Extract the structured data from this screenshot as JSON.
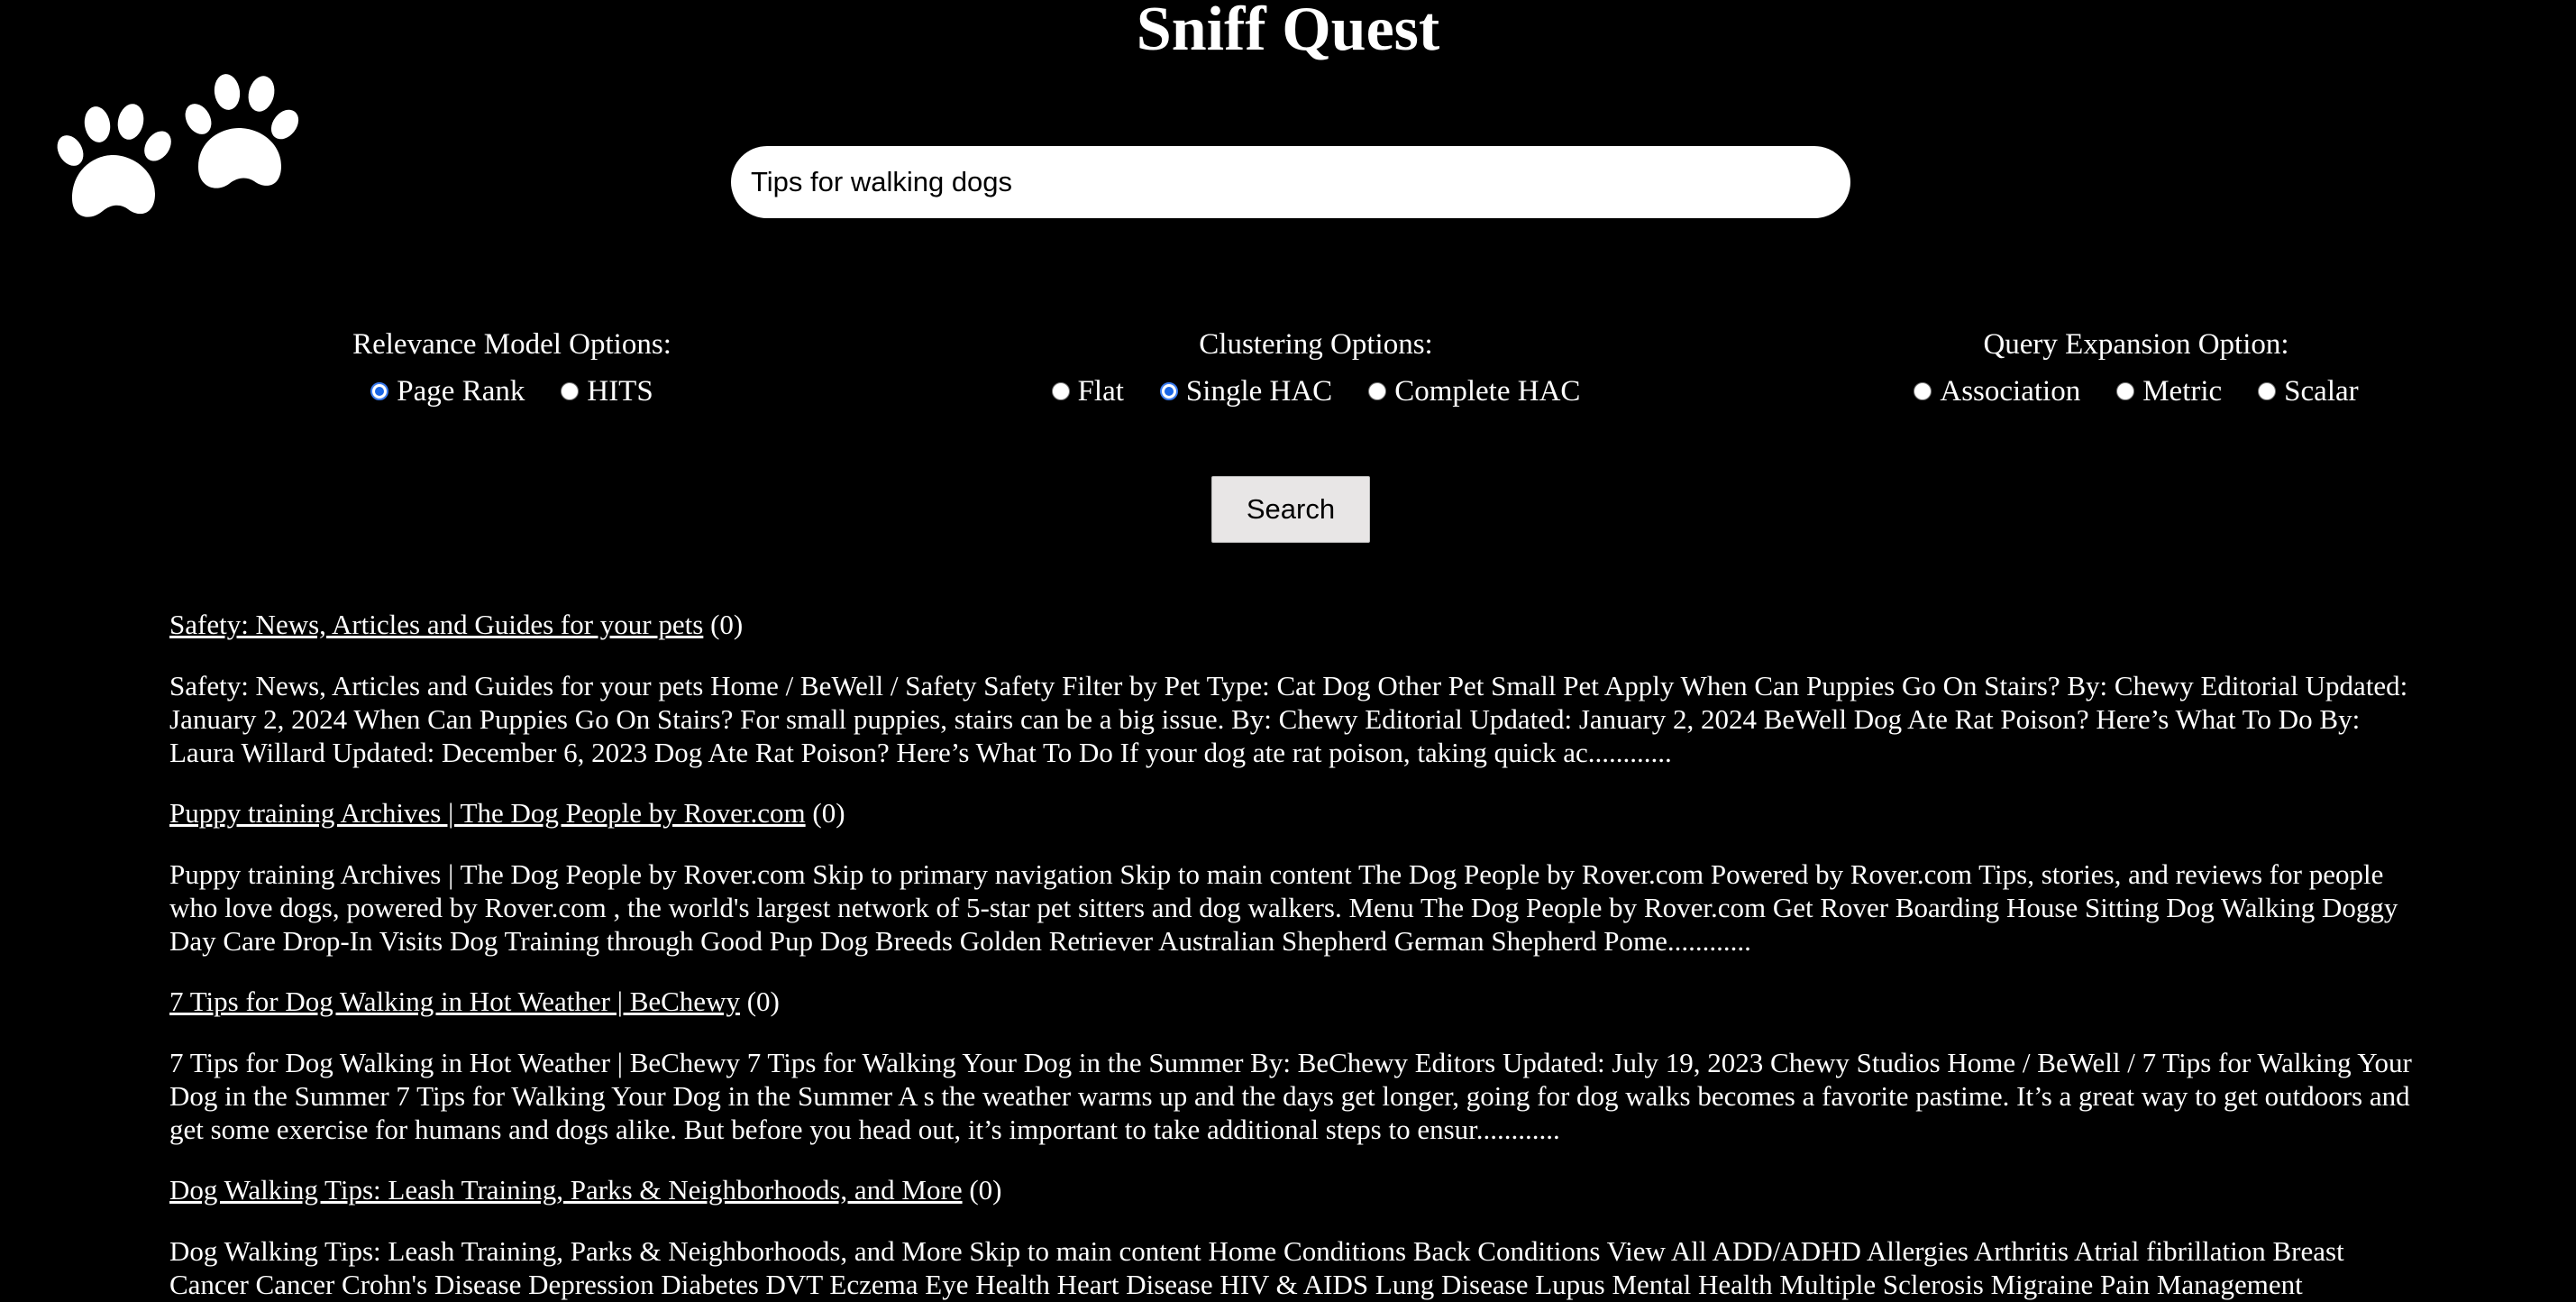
{
  "header": {
    "title": "Sniff Quest",
    "logo_icon": "paw-prints-icon"
  },
  "search": {
    "query": "Tips for walking dogs",
    "button_label": "Search"
  },
  "options": {
    "relevance": {
      "label": "Relevance Model Options:",
      "choices": [
        {
          "label": "Page Rank",
          "checked": true
        },
        {
          "label": "HITS",
          "checked": false
        }
      ]
    },
    "clustering": {
      "label": "Clustering Options:",
      "choices": [
        {
          "label": "Flat",
          "checked": false
        },
        {
          "label": "Single HAC",
          "checked": true
        },
        {
          "label": "Complete HAC",
          "checked": false
        }
      ]
    },
    "expansion": {
      "label": "Query Expansion Option:",
      "choices": [
        {
          "label": "Association",
          "checked": false
        },
        {
          "label": "Metric",
          "checked": false
        },
        {
          "label": "Scalar",
          "checked": false
        }
      ]
    }
  },
  "results": [
    {
      "title": "Safety: News, Articles and Guides for your pets",
      "count": "(0)",
      "snippet": "Safety: News, Articles and Guides for your pets Home / BeWell / Safety Safety Filter by Pet Type: Cat Dog Other Pet Small Pet Apply When Can Puppies Go On Stairs? By: Chewy Editorial Updated: January 2, 2024 When Can Puppies Go On Stairs? For small puppies, stairs can be a big issue. By: Chewy Editorial Updated: January 2, 2024 BeWell Dog Ate Rat Poison? Here’s What To Do By: Laura Willard Updated: December 6, 2023 Dog Ate Rat Poison? Here’s What To Do If your dog ate rat poison, taking quick ac............"
    },
    {
      "title": "Puppy training Archives | The Dog People by Rover.com",
      "count": "(0)",
      "snippet": "Puppy training Archives | The Dog People by Rover.com Skip to primary navigation Skip to main content The Dog People by Rover.com Powered by Rover.com Tips, stories, and reviews for people who love dogs, powered by Rover.com , the world's largest network of 5-star pet sitters and dog walkers. Menu The Dog People by Rover.com Get Rover Boarding House Sitting Dog Walking Doggy Day Care Drop-In Visits Dog Training through Good Pup Dog Breeds Golden Retriever Australian Shepherd German Shepherd Pome............"
    },
    {
      "title": "7 Tips for Dog Walking in Hot Weather | BeChewy",
      "count": "(0)",
      "snippet": "7 Tips for Dog Walking in Hot Weather | BeChewy 7 Tips for Walking Your Dog in the Summer By: BeChewy Editors Updated: July 19, 2023 Chewy Studios Home / BeWell / 7 Tips for Walking Your Dog in the Summer 7 Tips for Walking Your Dog in the Summer A s the weather warms up and the days get longer, going for dog walks becomes a favorite pastime. It’s a great way to get outdoors and get some exercise for humans and dogs alike. But before you head out, it’s important to take additional steps to ensur............"
    },
    {
      "title": "Dog Walking Tips: Leash Training, Parks & Neighborhoods, and More",
      "count": "(0)",
      "snippet": "Dog Walking Tips: Leash Training, Parks & Neighborhoods, and More Skip to main content Home Conditions Back Conditions View All ADD/ADHD Allergies Arthritis Atrial fibrillation Breast Cancer Cancer Crohn's Disease Depression Diabetes DVT Eczema Eye Health Heart Disease HIV & AIDS Lung Disease Lupus Mental Health Multiple Sclerosis Migraine Pain Management"
    }
  ]
}
